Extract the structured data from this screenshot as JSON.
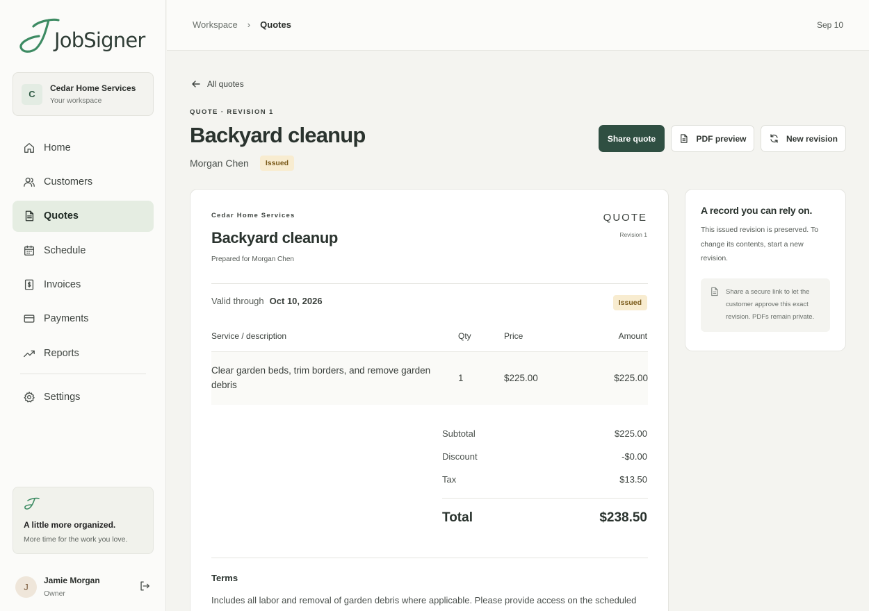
{
  "app": {
    "name": "JobSigner",
    "brand_color": "#2f4f42",
    "accent_color": "#3d8b63"
  },
  "workspace": {
    "initial": "C",
    "name": "Cedar Home Services",
    "subtitle": "Your workspace"
  },
  "sidebar": {
    "items": [
      {
        "label": "Home",
        "icon": "home-icon"
      },
      {
        "label": "Customers",
        "icon": "users-icon"
      },
      {
        "label": "Quotes",
        "icon": "document-icon",
        "active": true
      },
      {
        "label": "Schedule",
        "icon": "calendar-icon"
      },
      {
        "label": "Invoices",
        "icon": "invoice-icon"
      },
      {
        "label": "Payments",
        "icon": "credit-card-icon"
      },
      {
        "label": "Reports",
        "icon": "trending-up-icon"
      },
      {
        "label": "Settings",
        "icon": "gear-icon"
      }
    ]
  },
  "promo": {
    "title": "A little more organized.",
    "subtitle": "More time for the work you love."
  },
  "user": {
    "initial": "J",
    "name": "Jamie Morgan",
    "role": "Owner"
  },
  "topbar": {
    "breadcrumb": [
      "Workspace",
      "Quotes"
    ],
    "date": "Sep 10"
  },
  "page": {
    "back_label": "All quotes",
    "eyebrow": "QUOTE · REVISION 1",
    "title": "Backyard cleanup",
    "customer": "Morgan Chen",
    "status": "Issued"
  },
  "actions": {
    "share": "Share quote",
    "pdf": "PDF preview",
    "revision": "New revision"
  },
  "document": {
    "company": "Cedar Home Services",
    "label": "QUOTE",
    "title": "Backyard cleanup",
    "revision": "Revision 1",
    "prepared_for": "Prepared for Morgan Chen",
    "valid_label": "Valid through",
    "valid_date": "Oct 10, 2026",
    "status": "Issued",
    "columns": [
      "Service / description",
      "Qty",
      "Price",
      "Amount"
    ],
    "lines": [
      {
        "description": "Clear garden beds, trim borders, and remove garden debris",
        "qty": "1",
        "price": "$225.00",
        "amount": "$225.00"
      }
    ],
    "totals": {
      "subtotal_label": "Subtotal",
      "subtotal": "$225.00",
      "discount_label": "Discount",
      "discount": "-$0.00",
      "tax_label": "Tax",
      "tax": "$13.50",
      "total_label": "Total",
      "total": "$238.50"
    },
    "terms_title": "Terms",
    "terms_text": "Includes all labor and removal of garden debris where applicable. Please provide access on the scheduled"
  },
  "side_panel": {
    "title": "A record you can rely on.",
    "text": "This issued revision is preserved. To change its contents, start a new revision.",
    "note": "Share a secure link to let the customer approve this exact revision. PDFs remain private."
  }
}
